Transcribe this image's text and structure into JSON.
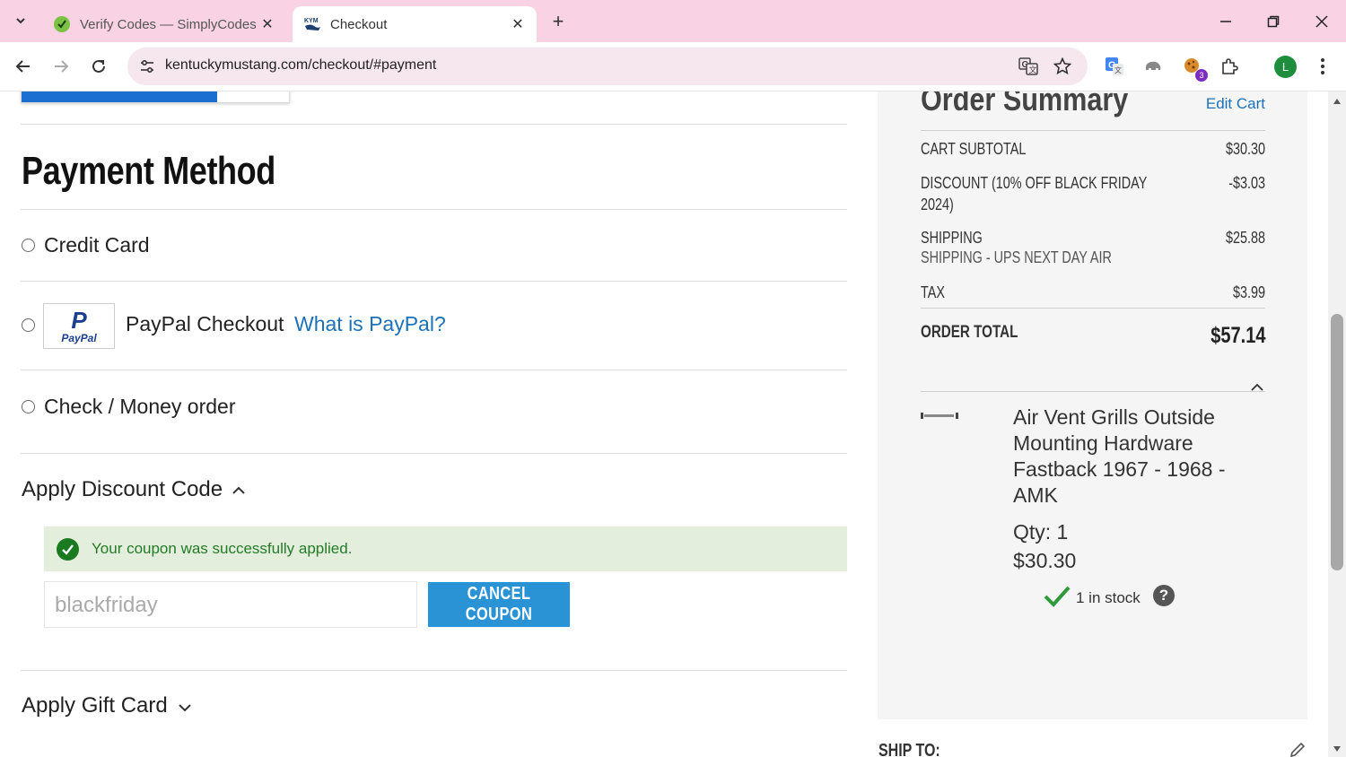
{
  "browser": {
    "tabs": [
      {
        "title": "Verify Codes — SimplyCodes",
        "active": false,
        "favicon": "simplycodes-icon"
      },
      {
        "title": "Checkout",
        "active": true,
        "favicon": "kym-logo-icon"
      }
    ],
    "url": "kentuckymustang.com/checkout/#payment",
    "profile_initial": "L",
    "extension_badge": "3"
  },
  "payment": {
    "title": "Payment Method",
    "options": [
      {
        "label": "Credit Card",
        "selected": false
      },
      {
        "label": "PayPal Checkout",
        "link": "What is PayPal?",
        "selected": false
      },
      {
        "label": "Check / Money order",
        "selected": false
      }
    ],
    "paypal_logo_text": "PayPal"
  },
  "discount": {
    "title": "Apply Discount Code",
    "expanded": true,
    "success_message": "Your coupon was successfully applied.",
    "code_value": "blackfriday",
    "cancel_label": "CANCEL COUPON"
  },
  "gift_card": {
    "title": "Apply Gift Card",
    "expanded": false
  },
  "summary": {
    "title": "Order Summary",
    "edit_cart": "Edit Cart",
    "rows": {
      "subtotal_label": "CART SUBTOTAL",
      "subtotal_value": "$30.30",
      "discount_label_1": "DISCOUNT (10% OFF BLACK FRIDAY",
      "discount_label_2": "2024)",
      "discount_value": "-$3.03",
      "shipping_label": "SHIPPING",
      "shipping_method": "SHIPPING - UPS NEXT DAY AIR",
      "shipping_value": "$25.88",
      "tax_label": "TAX",
      "tax_value": "$3.99"
    },
    "total_label": "ORDER TOTAL",
    "total_value": "$57.14",
    "item": {
      "name": "Air Vent Grills Outside Mounting Hardware Fastback 1967 - 1968 - AMK",
      "qty": "Qty: 1",
      "price": "$30.30",
      "stock": "1 in stock"
    },
    "ship_to": "SHIP TO:"
  },
  "colors": {
    "tab_bar": "#f9d2e3",
    "link": "#1b72b8",
    "button": "#2a93d5",
    "success_bg": "#e3efdc",
    "success_text": "#237a27"
  }
}
